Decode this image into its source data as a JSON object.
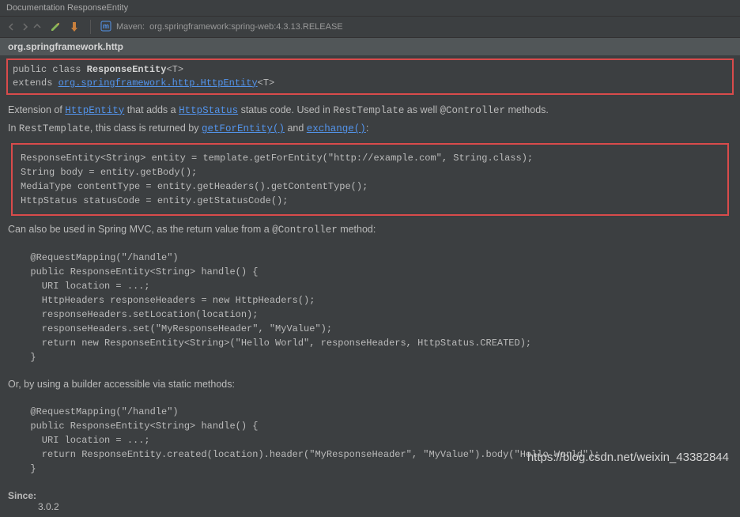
{
  "title": "Documentation ResponseEntity",
  "toolbar": {
    "module_prefix": "Maven:",
    "module_name": "org.springframework:spring-web:4.3.13.RELEASE"
  },
  "package_name": "org.springframework.http",
  "signature": {
    "modifiers": "public class ",
    "class_name": "ResponseEntity",
    "generic_t": "<T>",
    "extends_kw": "extends ",
    "super_link": "org.springframework.http.HttpEntity",
    "super_generic": "<T>"
  },
  "para1": {
    "prefix": "Extension of ",
    "link1": "HttpEntity",
    "mid1": " that adds a ",
    "link2": "HttpStatus",
    "mid2": " status code. Used in ",
    "mono1": "RestTemplate",
    "mid3": " as well ",
    "mono2": "@Controller",
    "suffix": " methods."
  },
  "para2": {
    "prefix": "In ",
    "mono1": "RestTemplate",
    "mid1": ", this class is returned by ",
    "link1": "getForEntity()",
    "mid2": " and ",
    "link2": "exchange()",
    "suffix": ":"
  },
  "code1": "ResponseEntity<String> entity = template.getForEntity(\"http://example.com\", String.class);\nString body = entity.getBody();\nMediaType contentType = entity.getHeaders().getContentType();\nHttpStatus statusCode = entity.getStatusCode();",
  "para3": {
    "prefix": "Can also be used in Spring MVC, as the return value from a ",
    "mono1": "@Controller",
    "suffix": " method:"
  },
  "code2": "  @RequestMapping(\"/handle\")\n  public ResponseEntity<String> handle() {\n    URI location = ...;\n    HttpHeaders responseHeaders = new HttpHeaders();\n    responseHeaders.setLocation(location);\n    responseHeaders.set(\"MyResponseHeader\", \"MyValue\");\n    return new ResponseEntity<String>(\"Hello World\", responseHeaders, HttpStatus.CREATED);\n  }",
  "para4": "Or, by using a builder accessible via static methods:",
  "code3": "  @RequestMapping(\"/handle\")\n  public ResponseEntity<String> handle() {\n    URI location = ...;\n    return ResponseEntity.created(location).header(\"MyResponseHeader\", \"MyValue\").body(\"Hello World\");\n  }",
  "since_label": "Since:",
  "since_value": "3.0.2",
  "watermark": "https://blog.csdn.net/weixin_43382844"
}
